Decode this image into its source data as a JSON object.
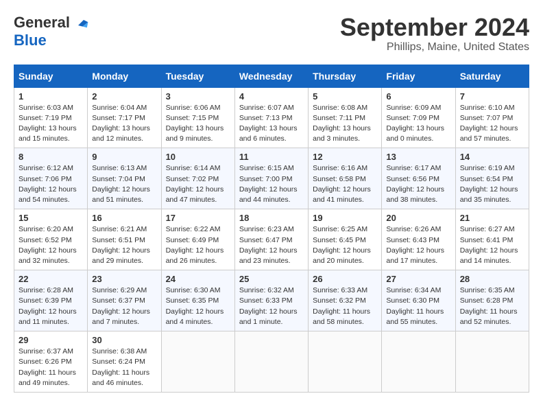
{
  "logo": {
    "general": "General",
    "blue": "Blue"
  },
  "title": "September 2024",
  "location": "Phillips, Maine, United States",
  "weekdays": [
    "Sunday",
    "Monday",
    "Tuesday",
    "Wednesday",
    "Thursday",
    "Friday",
    "Saturday"
  ],
  "weeks": [
    [
      {
        "day": 1,
        "info": "Sunrise: 6:03 AM\nSunset: 7:19 PM\nDaylight: 13 hours\nand 15 minutes."
      },
      {
        "day": 2,
        "info": "Sunrise: 6:04 AM\nSunset: 7:17 PM\nDaylight: 13 hours\nand 12 minutes."
      },
      {
        "day": 3,
        "info": "Sunrise: 6:06 AM\nSunset: 7:15 PM\nDaylight: 13 hours\nand 9 minutes."
      },
      {
        "day": 4,
        "info": "Sunrise: 6:07 AM\nSunset: 7:13 PM\nDaylight: 13 hours\nand 6 minutes."
      },
      {
        "day": 5,
        "info": "Sunrise: 6:08 AM\nSunset: 7:11 PM\nDaylight: 13 hours\nand 3 minutes."
      },
      {
        "day": 6,
        "info": "Sunrise: 6:09 AM\nSunset: 7:09 PM\nDaylight: 13 hours\nand 0 minutes."
      },
      {
        "day": 7,
        "info": "Sunrise: 6:10 AM\nSunset: 7:07 PM\nDaylight: 12 hours\nand 57 minutes."
      }
    ],
    [
      {
        "day": 8,
        "info": "Sunrise: 6:12 AM\nSunset: 7:06 PM\nDaylight: 12 hours\nand 54 minutes."
      },
      {
        "day": 9,
        "info": "Sunrise: 6:13 AM\nSunset: 7:04 PM\nDaylight: 12 hours\nand 51 minutes."
      },
      {
        "day": 10,
        "info": "Sunrise: 6:14 AM\nSunset: 7:02 PM\nDaylight: 12 hours\nand 47 minutes."
      },
      {
        "day": 11,
        "info": "Sunrise: 6:15 AM\nSunset: 7:00 PM\nDaylight: 12 hours\nand 44 minutes."
      },
      {
        "day": 12,
        "info": "Sunrise: 6:16 AM\nSunset: 6:58 PM\nDaylight: 12 hours\nand 41 minutes."
      },
      {
        "day": 13,
        "info": "Sunrise: 6:17 AM\nSunset: 6:56 PM\nDaylight: 12 hours\nand 38 minutes."
      },
      {
        "day": 14,
        "info": "Sunrise: 6:19 AM\nSunset: 6:54 PM\nDaylight: 12 hours\nand 35 minutes."
      }
    ],
    [
      {
        "day": 15,
        "info": "Sunrise: 6:20 AM\nSunset: 6:52 PM\nDaylight: 12 hours\nand 32 minutes."
      },
      {
        "day": 16,
        "info": "Sunrise: 6:21 AM\nSunset: 6:51 PM\nDaylight: 12 hours\nand 29 minutes."
      },
      {
        "day": 17,
        "info": "Sunrise: 6:22 AM\nSunset: 6:49 PM\nDaylight: 12 hours\nand 26 minutes."
      },
      {
        "day": 18,
        "info": "Sunrise: 6:23 AM\nSunset: 6:47 PM\nDaylight: 12 hours\nand 23 minutes."
      },
      {
        "day": 19,
        "info": "Sunrise: 6:25 AM\nSunset: 6:45 PM\nDaylight: 12 hours\nand 20 minutes."
      },
      {
        "day": 20,
        "info": "Sunrise: 6:26 AM\nSunset: 6:43 PM\nDaylight: 12 hours\nand 17 minutes."
      },
      {
        "day": 21,
        "info": "Sunrise: 6:27 AM\nSunset: 6:41 PM\nDaylight: 12 hours\nand 14 minutes."
      }
    ],
    [
      {
        "day": 22,
        "info": "Sunrise: 6:28 AM\nSunset: 6:39 PM\nDaylight: 12 hours\nand 11 minutes."
      },
      {
        "day": 23,
        "info": "Sunrise: 6:29 AM\nSunset: 6:37 PM\nDaylight: 12 hours\nand 7 minutes."
      },
      {
        "day": 24,
        "info": "Sunrise: 6:30 AM\nSunset: 6:35 PM\nDaylight: 12 hours\nand 4 minutes."
      },
      {
        "day": 25,
        "info": "Sunrise: 6:32 AM\nSunset: 6:33 PM\nDaylight: 12 hours\nand 1 minute."
      },
      {
        "day": 26,
        "info": "Sunrise: 6:33 AM\nSunset: 6:32 PM\nDaylight: 11 hours\nand 58 minutes."
      },
      {
        "day": 27,
        "info": "Sunrise: 6:34 AM\nSunset: 6:30 PM\nDaylight: 11 hours\nand 55 minutes."
      },
      {
        "day": 28,
        "info": "Sunrise: 6:35 AM\nSunset: 6:28 PM\nDaylight: 11 hours\nand 52 minutes."
      }
    ],
    [
      {
        "day": 29,
        "info": "Sunrise: 6:37 AM\nSunset: 6:26 PM\nDaylight: 11 hours\nand 49 minutes."
      },
      {
        "day": 30,
        "info": "Sunrise: 6:38 AM\nSunset: 6:24 PM\nDaylight: 11 hours\nand 46 minutes."
      },
      null,
      null,
      null,
      null,
      null
    ]
  ]
}
